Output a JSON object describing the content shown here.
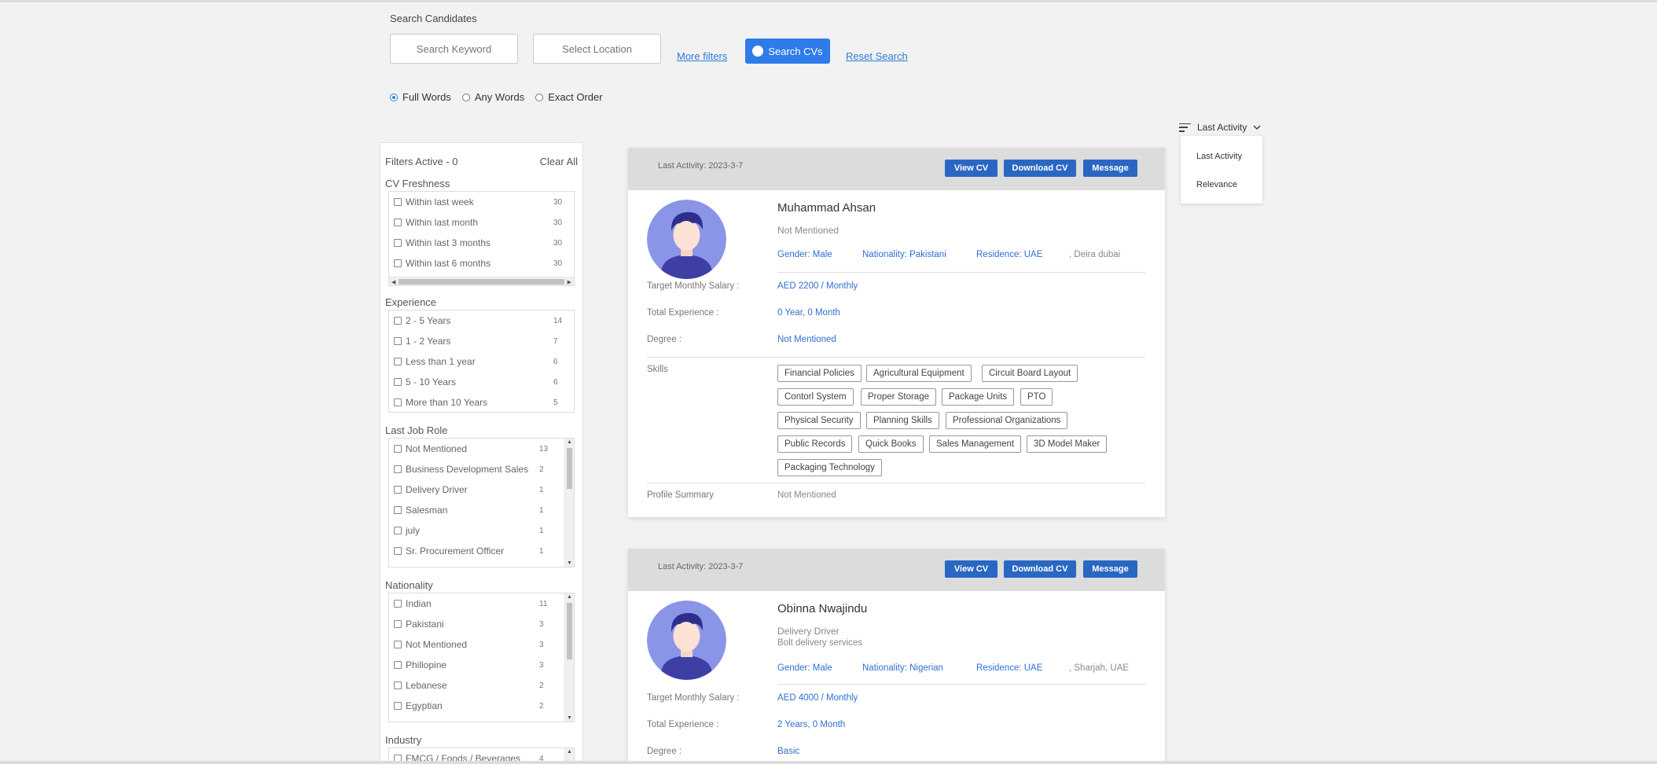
{
  "search": {
    "title": "Search Candidates",
    "keyword_placeholder": "Search Keyword",
    "location_placeholder": "Select Location",
    "more_filters": "More filters",
    "search_button": "Search CVs",
    "reset": "Reset Search",
    "radios": [
      {
        "label": "Full Words",
        "selected": true
      },
      {
        "label": "Any Words",
        "selected": false
      },
      {
        "label": "Exact Order",
        "selected": false
      }
    ]
  },
  "filters": {
    "active_label": "Filters Active - 0",
    "clear_all": "Clear All",
    "cv_freshness": {
      "title": "CV Freshness",
      "items": [
        {
          "label": "Within last week",
          "count": "30"
        },
        {
          "label": "Within last month",
          "count": "30"
        },
        {
          "label": "Within last 3 months",
          "count": "30"
        },
        {
          "label": "Within last 6 months",
          "count": "30"
        }
      ]
    },
    "experience": {
      "title": "Experience",
      "items": [
        {
          "label": "2 - 5 Years",
          "count": "14"
        },
        {
          "label": "1 - 2 Years",
          "count": "7"
        },
        {
          "label": "Less than 1 year",
          "count": "6"
        },
        {
          "label": "5 - 10 Years",
          "count": "6"
        },
        {
          "label": "More than 10 Years",
          "count": "5"
        }
      ]
    },
    "last_job_role": {
      "title": "Last Job Role",
      "items": [
        {
          "label": "Not Mentioned",
          "count": "13"
        },
        {
          "label": "Business Development Sales ...",
          "count": "2"
        },
        {
          "label": "Delivery Driver",
          "count": "1"
        },
        {
          "label": "Salesman",
          "count": "1"
        },
        {
          "label": "july",
          "count": "1"
        },
        {
          "label": "Sr. Procurement Officer",
          "count": "1"
        }
      ]
    },
    "nationality": {
      "title": "Nationality",
      "items": [
        {
          "label": "Indian",
          "count": "11"
        },
        {
          "label": "Pakistani",
          "count": "3"
        },
        {
          "label": "Not Mentioned",
          "count": "3"
        },
        {
          "label": "Phillopine",
          "count": "3"
        },
        {
          "label": "Lebanese",
          "count": "2"
        },
        {
          "label": "Egyptian",
          "count": "2"
        }
      ]
    },
    "industry": {
      "title": "Industry",
      "items": [
        {
          "label": "FMCG / Foods / Beverages",
          "count": "4"
        }
      ]
    }
  },
  "sort": {
    "current": "Last Activity",
    "options": [
      "Last Activity",
      "Relevance"
    ]
  },
  "cards": [
    {
      "last_activity": "Last Activity: 2023-3-7",
      "view_cv": "View CV",
      "download_cv": "Download CV",
      "message": "Message",
      "name": "Muhammad Ahsan",
      "role": "Not Mentioned",
      "company": "",
      "gender": "Gender: Male",
      "nationality": "Nationality: Pakistani",
      "residence": "Residence: UAE",
      "city": ", Deira dubai",
      "salary_label": "Target Monthly Salary :",
      "salary": "AED 2200 / Monthly",
      "experience_label": "Total Experience :",
      "experience": "0 Year, 0 Month",
      "degree_label": "Degree :",
      "degree": "Not Mentioned",
      "skills_label": "Skills",
      "skills": [
        [
          "Financial Policies",
          "Agricultural Equipment",
          "Circuit Board Layout"
        ],
        [
          "Contorl System",
          "Proper Storage",
          "Package Units",
          "PTO"
        ],
        [
          "Physical Security",
          "Planning Skills",
          "Professional Organizations"
        ],
        [
          "Public Records",
          "Quick Books",
          "Sales Management",
          "3D Model Maker"
        ],
        [
          "Packaging Technology"
        ]
      ],
      "summary_label": "Profile Summary",
      "summary": "Not Mentioned"
    },
    {
      "last_activity": "Last Activity: 2023-3-7",
      "view_cv": "View CV",
      "download_cv": "Download CV",
      "message": "Message",
      "name": "Obinna Nwajindu",
      "role": "Delivery Driver",
      "company": "Bolt delivery services",
      "gender": "Gender: Male",
      "nationality": "Nationality: Nigerian",
      "residence": "Residence: UAE",
      "city": ", Sharjah, UAE",
      "salary_label": "Target Monthly Salary :",
      "salary": "AED 4000 / Monthly",
      "experience_label": "Total Experience :",
      "experience": "2 Years, 0 Month",
      "degree_label": "Degree :",
      "degree": "Basic"
    }
  ]
}
